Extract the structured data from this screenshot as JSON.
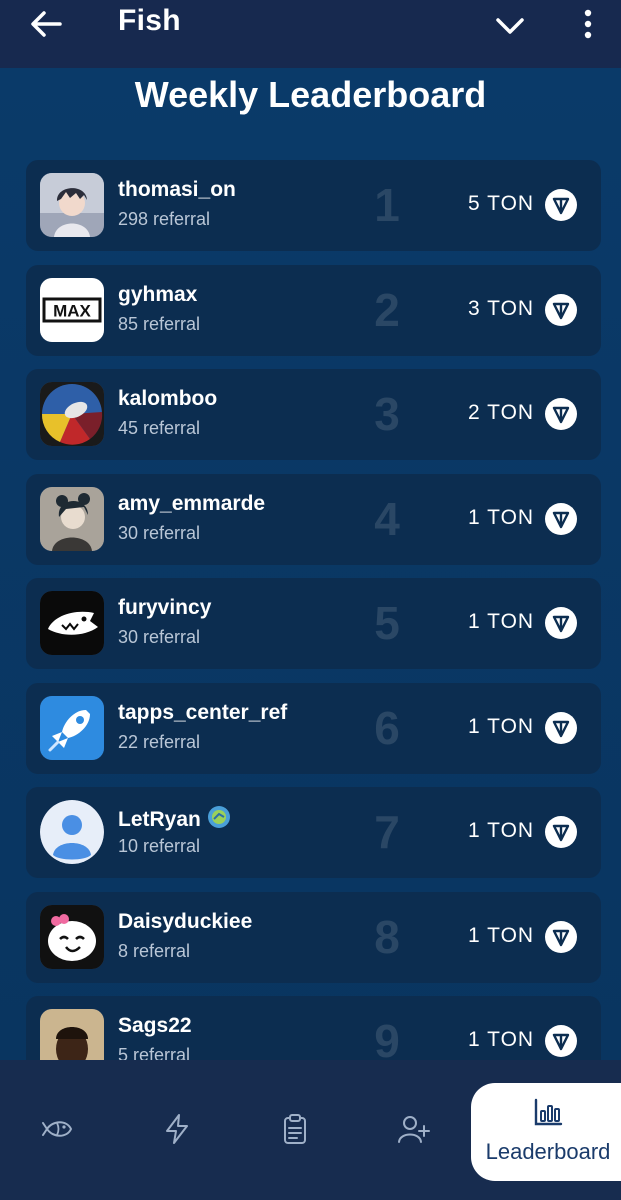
{
  "header": {
    "title": "Fish"
  },
  "page": {
    "heading": "Weekly Leaderboard"
  },
  "leaderboard": [
    {
      "rank": "1",
      "name": "thomasi_on",
      "referrals": "298 referral",
      "prize": "5 TON"
    },
    {
      "rank": "2",
      "name": "gyhmax",
      "referrals": "85 referral",
      "prize": "3 TON"
    },
    {
      "rank": "3",
      "name": "kalomboo",
      "referrals": "45 referral",
      "prize": "2 TON"
    },
    {
      "rank": "4",
      "name": "amy_emmarde",
      "referrals": "30 referral",
      "prize": "1 TON"
    },
    {
      "rank": "5",
      "name": "furyvincy",
      "referrals": "30 referral",
      "prize": "1 TON"
    },
    {
      "rank": "6",
      "name": "tapps_center_ref",
      "referrals": "22 referral",
      "prize": "1 TON"
    },
    {
      "rank": "7",
      "name": "LetRyan",
      "referrals": "10 referral",
      "prize": "1 TON"
    },
    {
      "rank": "8",
      "name": "Daisyduckiee",
      "referrals": "8 referral",
      "prize": "1 TON"
    },
    {
      "rank": "9",
      "name": "Sags22",
      "referrals": "5 referral",
      "prize": "1 TON"
    }
  ],
  "gyhmax_logo_text": "MAX",
  "bottom_nav": {
    "items": [
      "fish-icon",
      "lightning-icon",
      "clipboard-icon",
      "add-friend-icon"
    ],
    "active_label": "Leaderboard"
  },
  "colors": {
    "background": "#0b3a66",
    "card": "#0c2d50",
    "topbar": "#17294f",
    "rank_text": "#2a4765"
  }
}
